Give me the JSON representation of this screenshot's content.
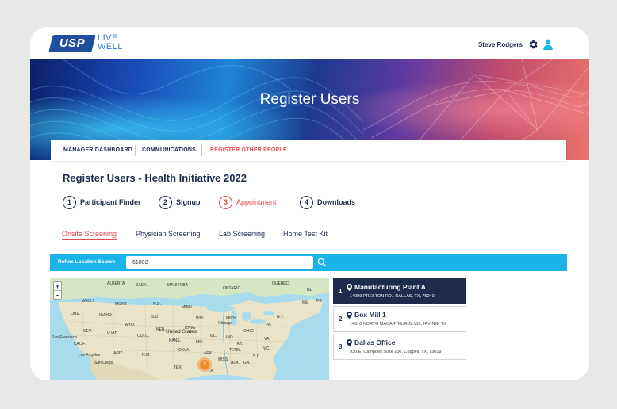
{
  "brand": {
    "logo_text": "USP",
    "tagline_line1": "LIVE",
    "tagline_line2": "WELL"
  },
  "header": {
    "user_name": "Steve Rodgers",
    "settings_icon": "gear-icon",
    "profile_icon": "user-icon"
  },
  "hero": {
    "title": "Register Users"
  },
  "nav": {
    "items": [
      {
        "label": "MANAGER DASHBOARD"
      },
      {
        "label": "COMMUNICATIONS"
      },
      {
        "label": "REGISTER OTHER PEOPLE",
        "active": true
      }
    ]
  },
  "page": {
    "heading": "Register Users - Health Initiative 2022"
  },
  "steps": [
    {
      "number": "1",
      "label": "Participant Finder"
    },
    {
      "number": "2",
      "label": "Signup"
    },
    {
      "number": "3",
      "label": "Appointment",
      "active": true
    },
    {
      "number": "4",
      "label": "Downloads"
    }
  ],
  "screening_tabs": [
    {
      "label": "Onsite Screening",
      "active": true
    },
    {
      "label": "Physician Screening"
    },
    {
      "label": "Lab Screening"
    },
    {
      "label": "Home Test Kit"
    }
  ],
  "search": {
    "label": "Refine Location Search",
    "value": "61802",
    "button_icon": "search-icon"
  },
  "map": {
    "zoom_in": "+",
    "zoom_out": "-",
    "country_label": "United States",
    "cluster_count": "3",
    "labels": {
      "alberta": "ALBERTA",
      "sask": "SASK.",
      "manitoba": "MANITOBA",
      "ontario": "ONTARIO",
      "quebec": "QUEBEC",
      "nl": "NL",
      "pe": "PE",
      "wash": "WASH.",
      "mont": "MONT.",
      "nd": "N.D.",
      "minn": "MINN.",
      "me": "ME",
      "ore": "ORE.",
      "idaho": "IDAHO",
      "sd": "S.D.",
      "wis": "WIS.",
      "mich": "MICH.",
      "ny": "N.Y.",
      "wyo": "WYO.",
      "iowa": "IOWA",
      "neb": "NEB.",
      "chicago": "Chicago",
      "pa": "PA.",
      "nev": "NEV.",
      "utah": "UTAH",
      "colo": "COLO.",
      "ill": "ILL.",
      "ind": "IND.",
      "ohio": "OHIO",
      "kans": "KANS.",
      "mo": "MO.",
      "ky": "KY.",
      "va": "VA.",
      "calif": "CALIF.",
      "sf": "San Francisco",
      "nc": "N.C.",
      "tenn": "TENN.",
      "okla": "OKLA.",
      "ark": "ARK.",
      "sc": "S.C.",
      "la_city": "Los Angeles",
      "ariz": "ARIZ.",
      "nm": "N.M.",
      "san_diego": "San Diego",
      "miss": "MISS.",
      "ala": "ALA.",
      "ga": "GA.",
      "tex": "TEX.",
      "la": "LA."
    }
  },
  "locations": [
    {
      "number": "1",
      "name": "Manufacturing Plant A",
      "address": "14999 PRESTON RD., DALLAS, TX, 75240",
      "selected": true
    },
    {
      "number": "2",
      "name": "Box Mill 1",
      "address": "14010 NORTH MACARTHUR BLVD., IRVING, TX"
    },
    {
      "number": "3",
      "name": "Dallas Office",
      "address": "930 E. Campbell Suite 200, Coppell, TX, 75019"
    }
  ],
  "colors": {
    "navy": "#1d2b4f",
    "accent_red": "#e5484d",
    "search_bar": "#1ab4e8",
    "brand_blue": "#1f4e9c"
  }
}
